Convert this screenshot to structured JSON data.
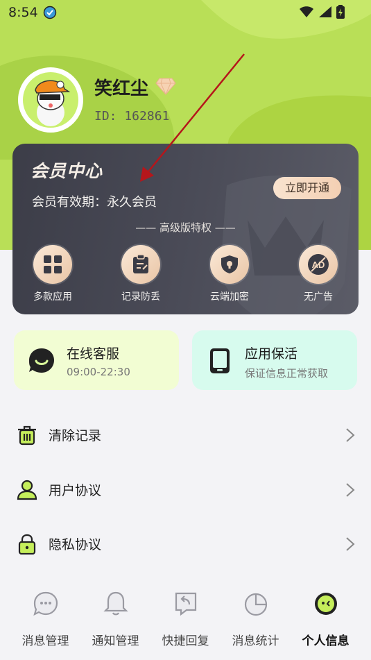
{
  "status_bar": {
    "time": "8:54"
  },
  "profile": {
    "username": "笑红尘",
    "user_id": "ID: 162861"
  },
  "vip_card": {
    "title": "会员中心",
    "validity": "会员有效期：永久会员",
    "open_button": "立即开通",
    "privilege_heading": "—— 高级版特权 ——",
    "features": [
      {
        "label": "多款应用",
        "icon": "grid-apps-icon"
      },
      {
        "label": "记录防丢",
        "icon": "clipboard-icon"
      },
      {
        "label": "云端加密",
        "icon": "shield-lock-icon"
      },
      {
        "label": "无广告",
        "icon": "ad-block-icon"
      }
    ]
  },
  "service_cards": [
    {
      "title": "在线客服",
      "subtitle": "09:00-22:30",
      "icon": "chat-bubble-icon"
    },
    {
      "title": "应用保活",
      "subtitle": "保证信息正常获取",
      "icon": "tablet-icon"
    }
  ],
  "menu": [
    {
      "label": "清除记录",
      "icon": "trash-icon"
    },
    {
      "label": "用户协议",
      "icon": "user-icon"
    },
    {
      "label": "隐私协议",
      "icon": "lock-icon"
    }
  ],
  "tabs": [
    {
      "label": "消息管理",
      "icon": "message-icon",
      "active": false
    },
    {
      "label": "通知管理",
      "icon": "bell-icon",
      "active": false
    },
    {
      "label": "快捷回复",
      "icon": "reply-icon",
      "active": false
    },
    {
      "label": "消息统计",
      "icon": "pie-chart-icon",
      "active": false
    },
    {
      "label": "个人信息",
      "icon": "profile-face-icon",
      "active": true
    }
  ],
  "colors": {
    "accent_green": "#b8de55",
    "card_dark": "#44454f",
    "gold": "#f3cfb3",
    "online_card_bg": "#f2fdd3",
    "keepalive_card_bg": "#d7fbee"
  }
}
